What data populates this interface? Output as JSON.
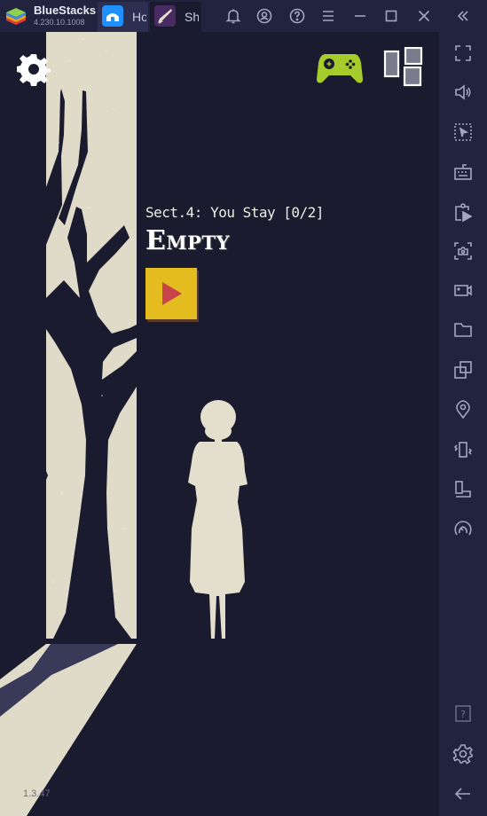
{
  "titlebar": {
    "app_name": "BlueStacks",
    "app_version": "4.230.10.1008",
    "tabs": [
      {
        "label": "Home",
        "icon": "home-icon",
        "color": "#1e90ff"
      },
      {
        "label": "Shelter",
        "icon": "game-app-icon",
        "color": "#4a2a63"
      }
    ],
    "controls": [
      "bell-icon",
      "account-icon",
      "help-icon",
      "menu-icon",
      "minimize-icon",
      "maximize-icon",
      "close-icon",
      "collapse-sidebar-icon"
    ]
  },
  "game": {
    "section_label": "Sect.4: You Stay [0/2]",
    "chapter_title": "Empty",
    "play_button_label": "Play",
    "version": "1.3.47",
    "colors": {
      "background": "#1a1b2e",
      "light": "#e4dfcd",
      "play_button": "#e5bc1f",
      "play_arrow": "#c9434a",
      "gamepad": "#a6cc2c"
    }
  },
  "sidebar": {
    "items": [
      "fullscreen-icon",
      "volume-icon",
      "pointer-select-icon",
      "keyboard-icon",
      "screen-record-icon",
      "screenshot-icon",
      "video-icon",
      "folder-icon",
      "multi-instance-icon",
      "location-icon",
      "shake-icon",
      "rotate-icon",
      "eco-mode-icon",
      "help-icon",
      "settings-icon",
      "back-icon"
    ]
  }
}
